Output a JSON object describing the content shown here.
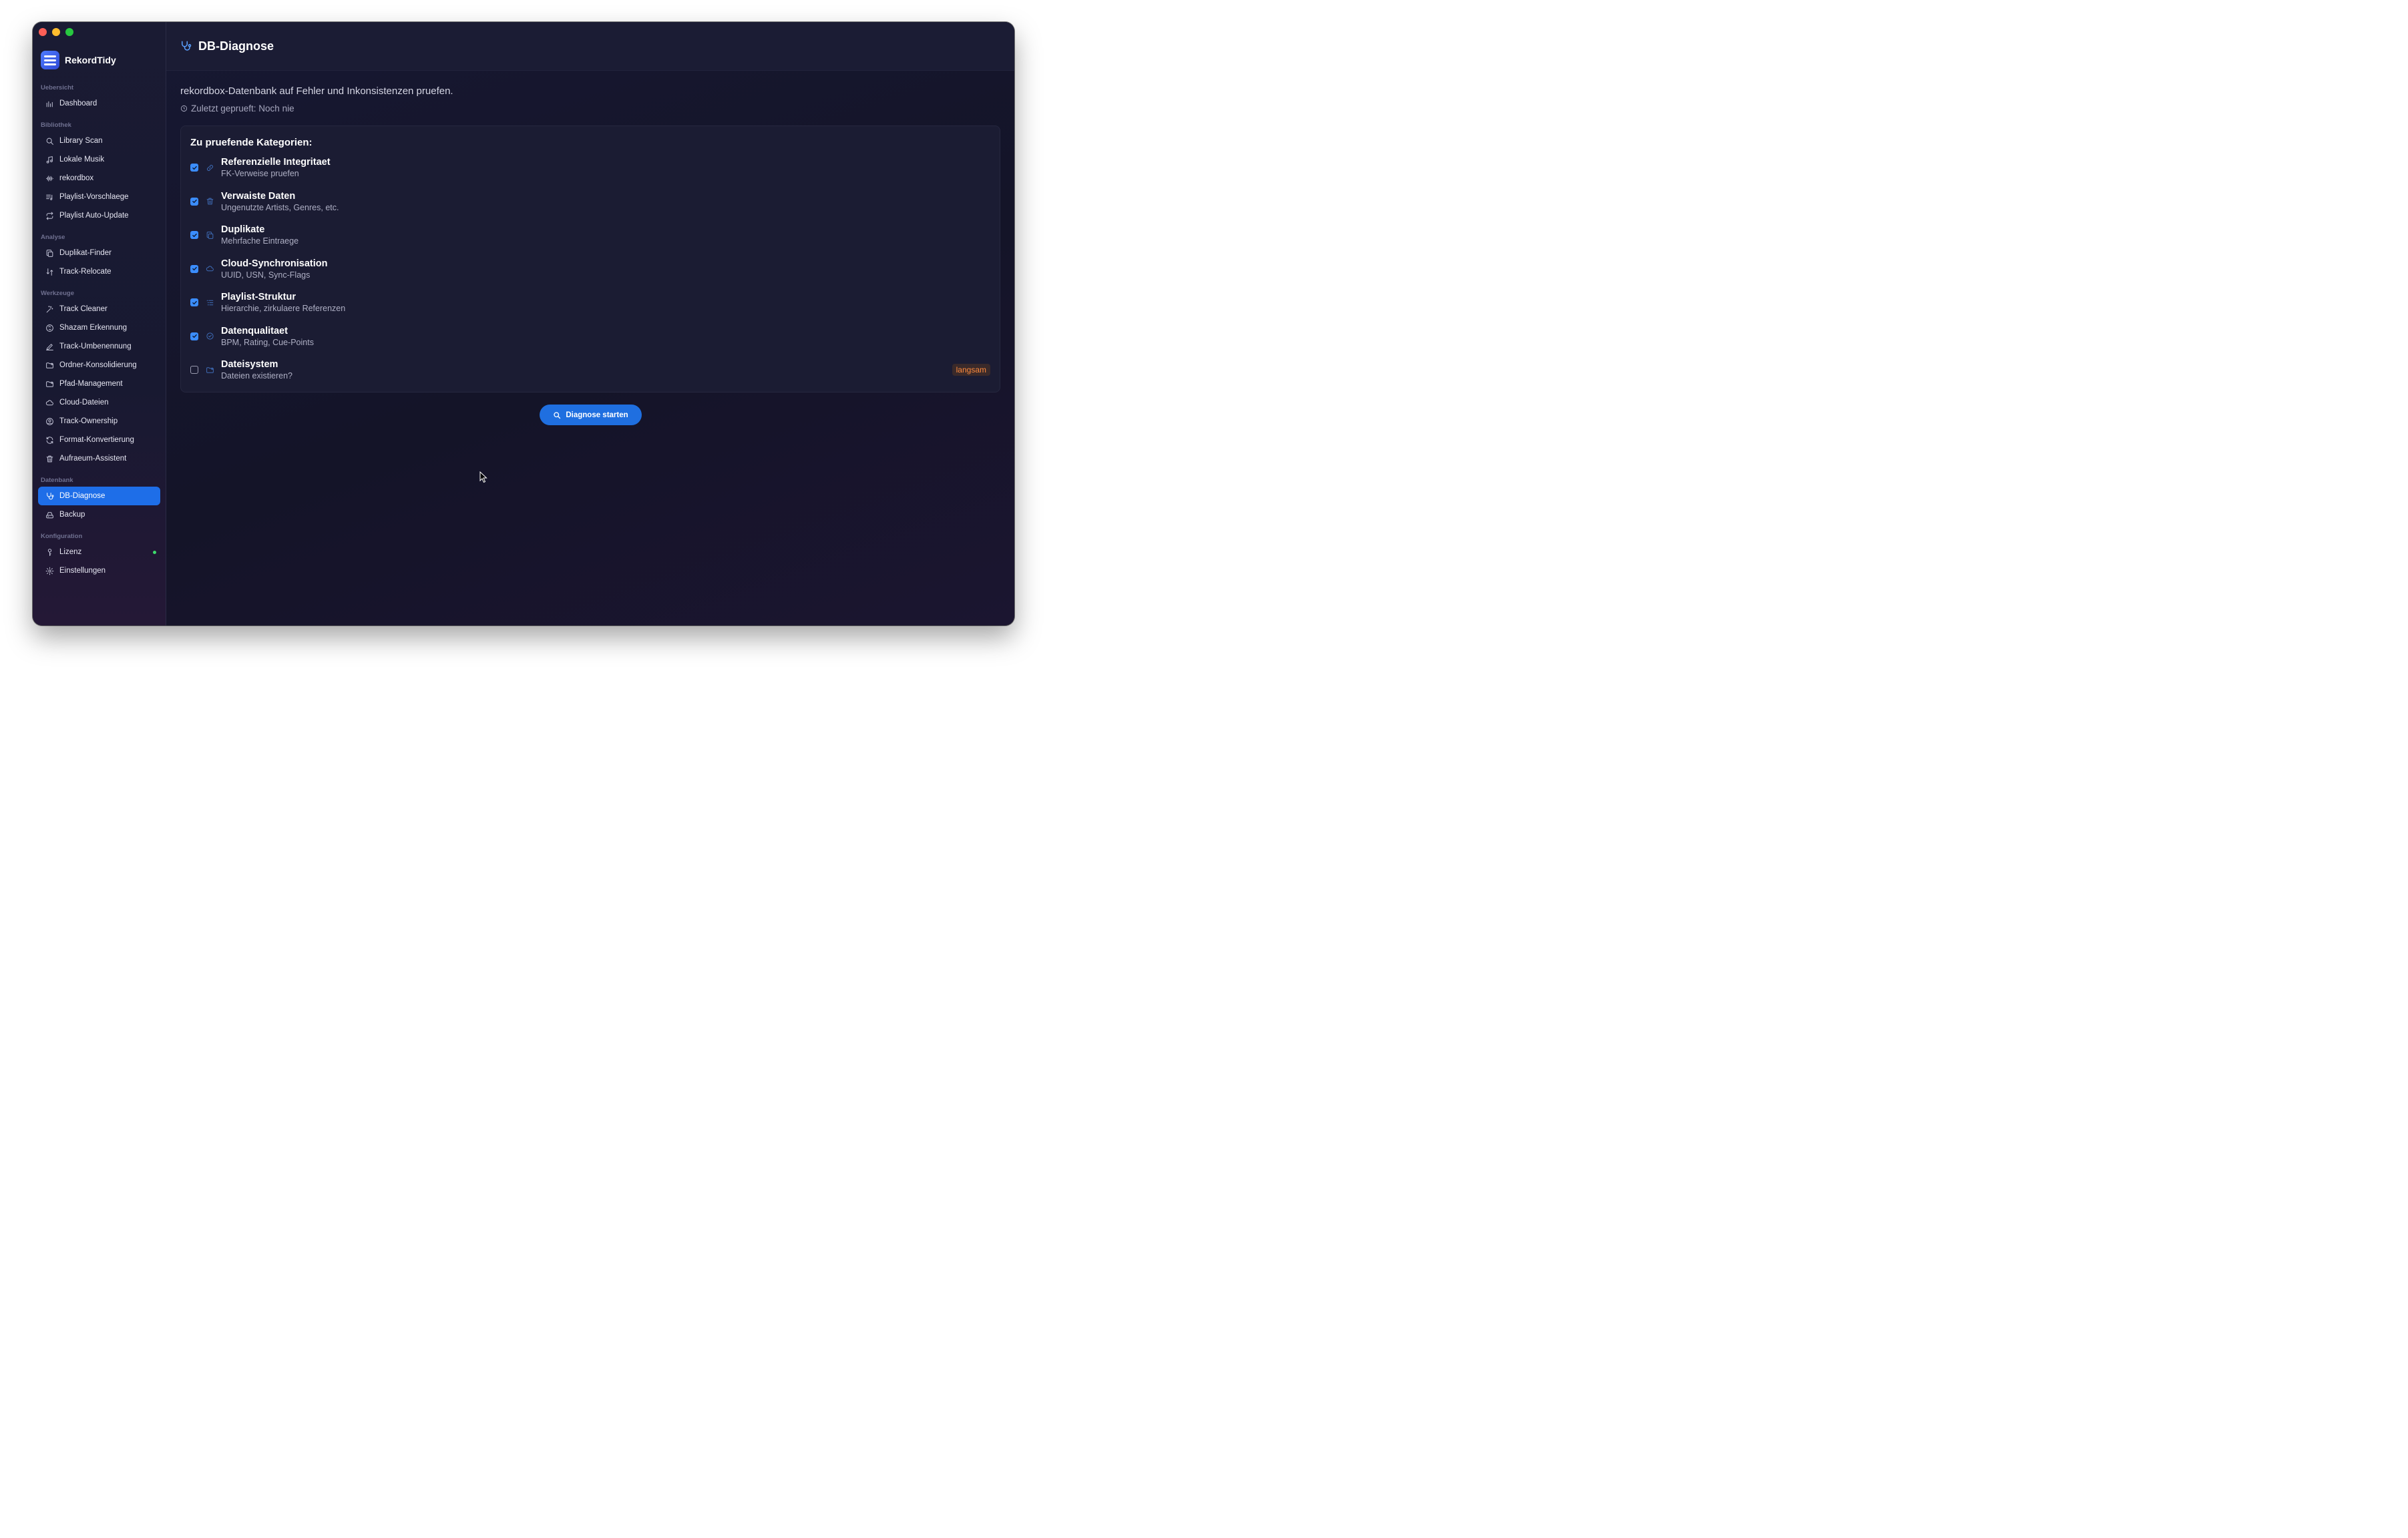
{
  "app": {
    "name": "RekordTidy"
  },
  "sidebar": {
    "sections": [
      {
        "label": "Uebersicht",
        "items": [
          {
            "label": "Dashboard",
            "icon": "bar-chart-icon"
          }
        ]
      },
      {
        "label": "Bibliothek",
        "items": [
          {
            "label": "Library Scan",
            "icon": "search-icon"
          },
          {
            "label": "Lokale Musik",
            "icon": "music-note-icon"
          },
          {
            "label": "rekordbox",
            "icon": "waveform-icon"
          },
          {
            "label": "Playlist-Vorschlaege",
            "icon": "playlist-icon"
          },
          {
            "label": "Playlist Auto-Update",
            "icon": "repeat-icon"
          }
        ]
      },
      {
        "label": "Analyse",
        "items": [
          {
            "label": "Duplikat-Finder",
            "icon": "copy-icon"
          },
          {
            "label": "Track-Relocate",
            "icon": "relocate-icon"
          }
        ]
      },
      {
        "label": "Werkzeuge",
        "items": [
          {
            "label": "Track Cleaner",
            "icon": "wand-icon"
          },
          {
            "label": "Shazam Erkennung",
            "icon": "shazam-icon"
          },
          {
            "label": "Track-Umbenennung",
            "icon": "pencil-icon"
          },
          {
            "label": "Ordner-Konsolidierung",
            "icon": "folder-icon"
          },
          {
            "label": "Pfad-Management",
            "icon": "folder-path-icon"
          },
          {
            "label": "Cloud-Dateien",
            "icon": "cloud-icon"
          },
          {
            "label": "Track-Ownership",
            "icon": "user-circle-icon"
          },
          {
            "label": "Format-Konvertierung",
            "icon": "refresh-icon"
          },
          {
            "label": "Aufraeum-Assistent",
            "icon": "trash-icon"
          }
        ]
      },
      {
        "label": "Datenbank",
        "items": [
          {
            "label": "DB-Diagnose",
            "icon": "stethoscope-icon",
            "active": true
          },
          {
            "label": "Backup",
            "icon": "drive-icon"
          }
        ]
      },
      {
        "label": "Konfiguration",
        "items": [
          {
            "label": "Lizenz",
            "icon": "key-icon",
            "status_dot": true
          },
          {
            "label": "Einstellungen",
            "icon": "gear-icon"
          }
        ]
      }
    ]
  },
  "header": {
    "title": "DB-Diagnose",
    "icon": "stethoscope-icon"
  },
  "main": {
    "description": "rekordbox-Datenbank auf Fehler und Inkonsistenzen pruefen.",
    "last_checked": "Zuletzt geprueft: Noch nie",
    "categories_title": "Zu pruefende Kategorien:",
    "categories": [
      {
        "name": "Referenzielle Integritaet",
        "sub": "FK-Verweise pruefen",
        "checked": true,
        "icon": "link-icon"
      },
      {
        "name": "Verwaiste Daten",
        "sub": "Ungenutzte Artists, Genres, etc.",
        "checked": true,
        "icon": "trash-icon"
      },
      {
        "name": "Duplikate",
        "sub": "Mehrfache Eintraege",
        "checked": true,
        "icon": "copy-icon"
      },
      {
        "name": "Cloud-Synchronisation",
        "sub": "UUID, USN, Sync-Flags",
        "checked": true,
        "icon": "cloud-icon"
      },
      {
        "name": "Playlist-Struktur",
        "sub": "Hierarchie, zirkulaere Referenzen",
        "checked": true,
        "icon": "list-icon"
      },
      {
        "name": "Datenqualitaet",
        "sub": "BPM, Rating, Cue-Points",
        "checked": true,
        "icon": "check-seal-icon"
      },
      {
        "name": "Dateisystem",
        "sub": "Dateien existieren?",
        "checked": false,
        "icon": "folder-icon",
        "badge": "langsam"
      }
    ],
    "start_button": "Diagnose starten"
  },
  "colors": {
    "accent": "#1f6fe0",
    "badge_text": "#ff8a3d",
    "status_dot": "#3ddc6c"
  }
}
